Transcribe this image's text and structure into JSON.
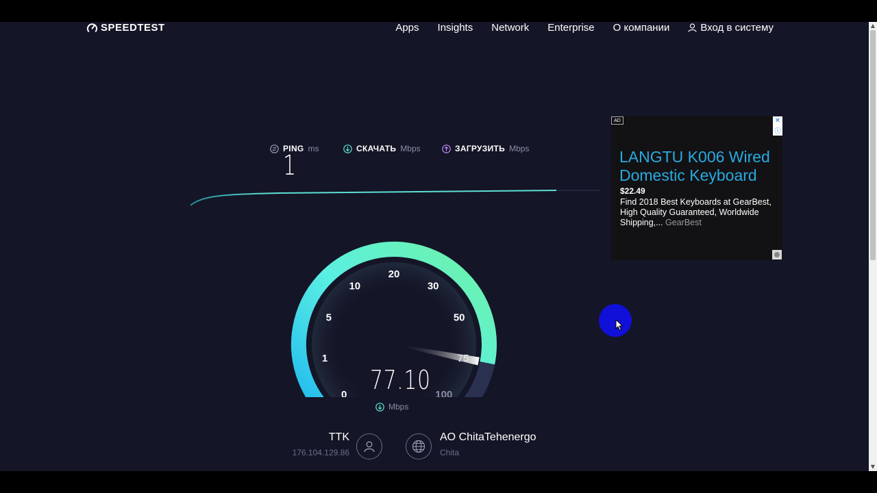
{
  "brand": {
    "logo_text": "SPEEDTEST"
  },
  "nav": {
    "items": [
      "Apps",
      "Insights",
      "Network",
      "Enterprise",
      "О компании"
    ],
    "login": "Вход в систему"
  },
  "metrics": {
    "ping": {
      "label": "PING",
      "unit": "ms",
      "value": "1"
    },
    "download": {
      "label": "СКАЧАТЬ",
      "unit": "Mbps"
    },
    "upload": {
      "label": "ЗАГРУЗИТЬ",
      "unit": "Mbps"
    }
  },
  "gauge": {
    "ticks": [
      "0",
      "1",
      "5",
      "10",
      "20",
      "30",
      "50",
      "75",
      "100"
    ],
    "needle_tick_fraction": 0.875,
    "value": "77.10",
    "unit": "Mbps"
  },
  "isp": {
    "name": "TTK",
    "ip": "176.104.129.86"
  },
  "server": {
    "name": "AO ChitaTehenergo",
    "city": "Chita"
  },
  "ad": {
    "badge": "AD",
    "headline": "LANGTU K006 Wired Domestic Keyboard",
    "price": "$22.49",
    "description": "Find 2018 Best Keyboards at GearBest, High Quality Guaranteed, Worldwide Shipping,...",
    "advertiser": "GearBest"
  },
  "colors": {
    "background": "#141526",
    "gauge_start": "#1fb8f0",
    "gauge_end": "#6ff2a4",
    "download_accent": "#5ce0d4",
    "upload_accent": "#b98af2"
  }
}
